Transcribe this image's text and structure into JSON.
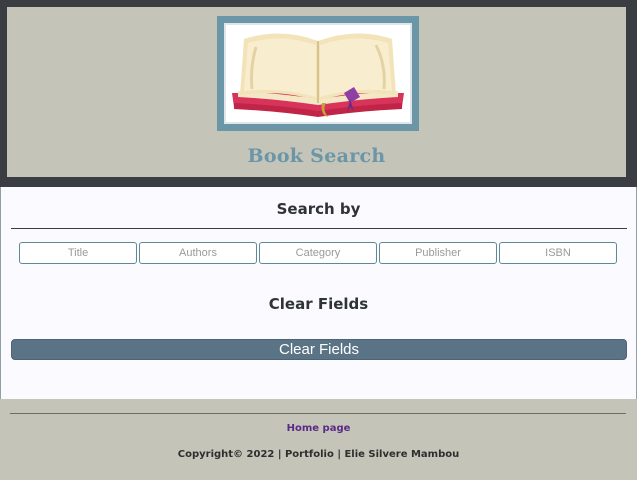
{
  "header": {
    "logo_icon": "open-book-icon",
    "title": "Book Search"
  },
  "search": {
    "heading": "Search by",
    "fields": [
      {
        "placeholder": "Title"
      },
      {
        "placeholder": "Authors"
      },
      {
        "placeholder": "Category"
      },
      {
        "placeholder": "Publisher"
      },
      {
        "placeholder": "ISBN"
      }
    ]
  },
  "clear": {
    "heading": "Clear Fields",
    "button_label": "Clear Fields"
  },
  "footer": {
    "home_link": "Home page",
    "copyright": "Copyright© 2022 | Portfolio | Elie Silvere Mambou"
  },
  "colors": {
    "header_bg": "#c5c4b8",
    "accent": "#6a96a7",
    "button_bg": "#5a7385",
    "link": "#5b2a86"
  }
}
